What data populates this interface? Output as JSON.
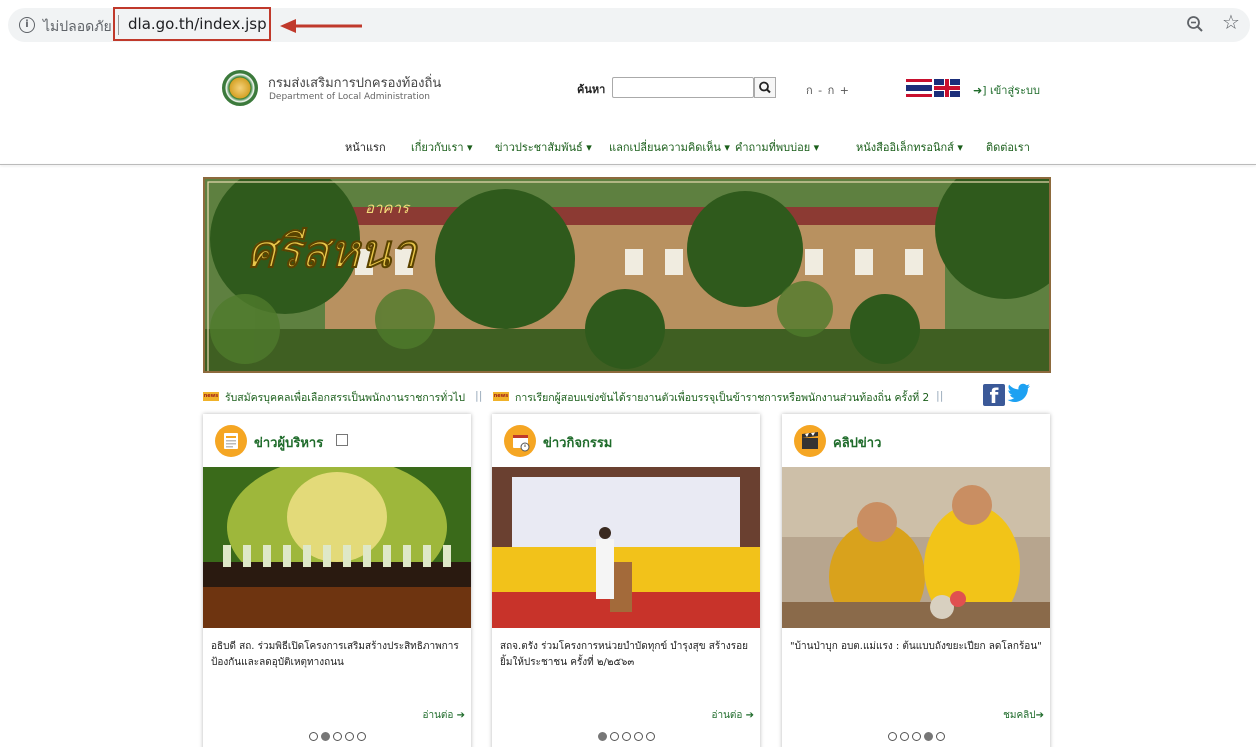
{
  "browser": {
    "security_label": "ไม่ปลอดภัย",
    "url": "dla.go.th/index.jsp",
    "annotation_color": "#c0392b"
  },
  "header": {
    "org_name_th": "กรมส่งเสริมการปกครองท้องถิ่น",
    "org_name_en": "Department of Local Administration",
    "search_label": "ค้นหา",
    "search_value": "",
    "font_controls": "ก -  ก +",
    "login_label": "เข้าสู่ระบบ"
  },
  "nav": {
    "items": [
      "หน้าแรก",
      "เกี่ยวกับเรา ▾",
      "ข่าวประชาสัมพันธ์ ▾",
      "แลกเปลี่ยนความคิดเห็น ▾",
      "คำถามที่พบบ่อย ▾",
      "หนังสืออิเล็กทรอนิกส์ ▾",
      "ติดต่อเรา"
    ]
  },
  "banner": {
    "logo_text": "อาคาร"
  },
  "ticker": {
    "tag": "news",
    "items": [
      "รับสมัครบุคคลเพื่อเลือกสรรเป็นพนักงานราชการทั่วไป",
      "การเรียกผู้สอบแข่งขันได้รายงานตัวเพื่อบรรจุเป็นข้าราชการหรือพนักงานส่วนท้องถิ่น ครั้งที่ 2"
    ],
    "separator": "||"
  },
  "cards": [
    {
      "title": "ข่าวผู้บริหาร",
      "text": "อธิบดี สถ. ร่วมพิธีเปิดโครงการเสริมสร้างประสิทธิภาพการป้องกันและลดอุบัติเหตุทางถนน",
      "link": "อ่านต่อ",
      "active_dot": 1
    },
    {
      "title": "ข่าวกิจกรรม",
      "text": "สถจ.ตรัง ร่วมโครงการหน่วยบำบัดทุกข์ บำรุงสุข สร้างรอยยิ้มให้ประชาชน ครั้งที่ ๒/๒๕๖๓",
      "link": "อ่านต่อ",
      "active_dot": 0
    },
    {
      "title": "คลิปข่าว",
      "text": "\"บ้านป่าบุก อบต.แม่แรง : ต้นแบบถังขยะเปียก ลดโลกร้อน\"",
      "link": "ชมคลิป",
      "active_dot": 3
    }
  ],
  "colors": {
    "brand_green": "#1e6b2a",
    "accent_orange": "#f5a623"
  }
}
